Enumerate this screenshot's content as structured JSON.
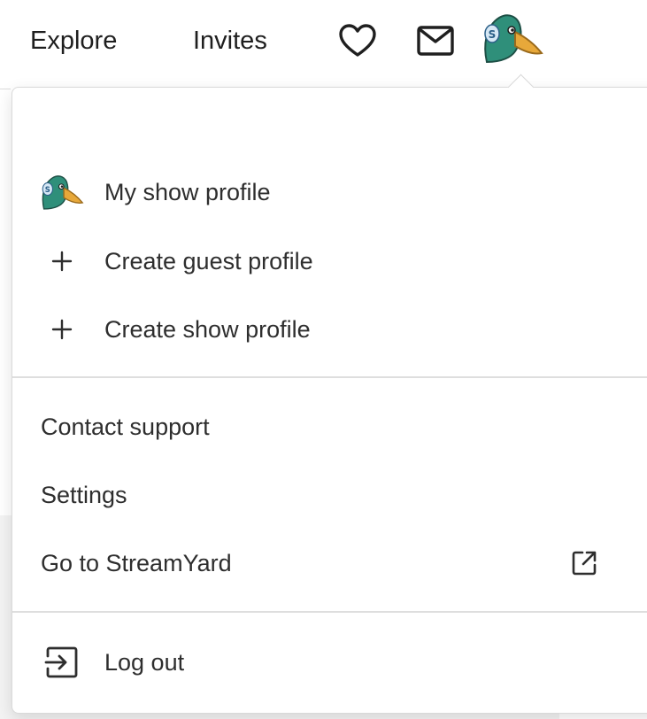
{
  "topnav": {
    "explore": "Explore",
    "invites": "Invites",
    "icons": [
      "heart-icon",
      "mail-icon",
      "duck-avatar"
    ]
  },
  "menu": {
    "my_show_profile": "My show profile",
    "create_guest_profile": "Create guest profile",
    "create_show_profile": "Create show profile",
    "contact_support": "Contact support",
    "settings": "Settings",
    "go_to_streamyard": "Go to StreamYard",
    "log_out": "Log out"
  },
  "colors": {
    "text": "#2e2e2e",
    "divider": "#dedede",
    "duck_head": "#2f8f7a",
    "duck_beak": "#e7a83a",
    "badge": "#d6e8f5"
  }
}
